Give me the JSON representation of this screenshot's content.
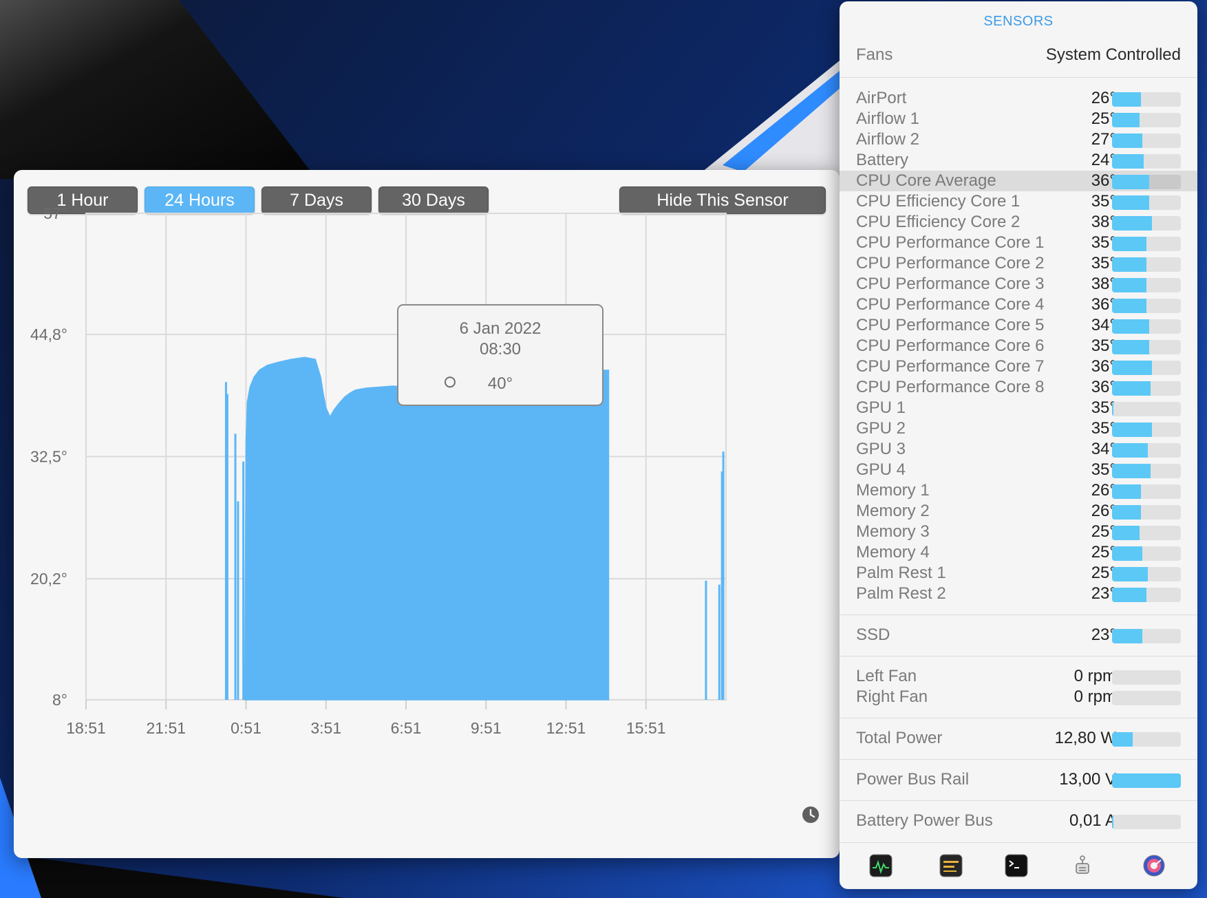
{
  "panel": {
    "title": "SENSORS",
    "fans_label": "Fans",
    "fans_value": "System Controlled",
    "temperature_sensors": [
      {
        "name": "AirPort",
        "value": "26°",
        "level": 0.42
      },
      {
        "name": "Airflow 1",
        "value": "25°",
        "level": 0.4
      },
      {
        "name": "Airflow 2",
        "value": "27°",
        "level": 0.44
      },
      {
        "name": "Battery",
        "value": "24°",
        "level": 0.46
      },
      {
        "name": "CPU Core Average",
        "value": "36°",
        "level": 0.54,
        "highlighted": true
      },
      {
        "name": "CPU Efficiency Core 1",
        "value": "35°",
        "level": 0.54
      },
      {
        "name": "CPU Efficiency Core 2",
        "value": "38°",
        "level": 0.58
      },
      {
        "name": "CPU Performance Core 1",
        "value": "35°",
        "level": 0.5
      },
      {
        "name": "CPU Performance Core 2",
        "value": "35°",
        "level": 0.5
      },
      {
        "name": "CPU Performance Core 3",
        "value": "38°",
        "level": 0.5
      },
      {
        "name": "CPU Performance Core 4",
        "value": "36°",
        "level": 0.5
      },
      {
        "name": "CPU Performance Core 5",
        "value": "34°",
        "level": 0.54
      },
      {
        "name": "CPU Performance Core 6",
        "value": "35°",
        "level": 0.54
      },
      {
        "name": "CPU Performance Core 7",
        "value": "36°",
        "level": 0.58
      },
      {
        "name": "CPU Performance Core 8",
        "value": "36°",
        "level": 0.56
      },
      {
        "name": "GPU 1",
        "value": "35°",
        "level": 0.02
      },
      {
        "name": "GPU 2",
        "value": "35°",
        "level": 0.58
      },
      {
        "name": "GPU 3",
        "value": "34°",
        "level": 0.52
      },
      {
        "name": "GPU 4",
        "value": "35°",
        "level": 0.56
      },
      {
        "name": "Memory 1",
        "value": "26°",
        "level": 0.42
      },
      {
        "name": "Memory 2",
        "value": "26°",
        "level": 0.42
      },
      {
        "name": "Memory 3",
        "value": "25°",
        "level": 0.4
      },
      {
        "name": "Memory 4",
        "value": "25°",
        "level": 0.44
      },
      {
        "name": "Palm Rest 1",
        "value": "25°",
        "level": 0.52
      },
      {
        "name": "Palm Rest 2",
        "value": "23°",
        "level": 0.5
      }
    ],
    "ssd": {
      "name": "SSD",
      "value": "23°",
      "level": 0.44
    },
    "fans": [
      {
        "name": "Left Fan",
        "value": "0 rpm",
        "level": 0
      },
      {
        "name": "Right Fan",
        "value": "0 rpm",
        "level": 0
      }
    ],
    "total_power": {
      "name": "Total Power",
      "value": "12,80 W",
      "level": 0.3
    },
    "power_bus_rail": {
      "name": "Power Bus Rail",
      "value": "13,00 V",
      "level": 1.0
    },
    "battery_power_bus": {
      "name": "Battery Power Bus",
      "value": "0,01 A",
      "level": 0.02
    },
    "dock_icons": [
      "activity-monitor-icon",
      "console-icon",
      "terminal-icon",
      "system-information-icon",
      "disk-utility-icon"
    ]
  },
  "history": {
    "range_buttons": [
      "1 Hour",
      "24 Hours",
      "7 Days",
      "30 Days"
    ],
    "active_range": "24 Hours",
    "hide_button": "Hide This Sensor",
    "tooltip": {
      "date": "6 Jan 2022",
      "time": "08:30",
      "value": "40°"
    },
    "reset_icon": "clock-icon"
  },
  "chart_data": {
    "type": "area",
    "ytick_labels": [
      "57°",
      "44,8°",
      "32,5°",
      "20,2°",
      "8°"
    ],
    "yticks": [
      57,
      44.8,
      32.5,
      20.2,
      8
    ],
    "ylim": [
      8,
      57
    ],
    "xtick_labels": [
      "18:51",
      "21:51",
      "0:51",
      "3:51",
      "6:51",
      "9:51",
      "12:51",
      "15:51"
    ],
    "xlim_hours": [
      0,
      24
    ],
    "grid": true,
    "color": "#5cb6f5",
    "main_series": {
      "x_hours": [
        5.95,
        6.0,
        6.05,
        6.15,
        6.3,
        6.5,
        6.8,
        7.2,
        7.7,
        8.2,
        8.6,
        8.8,
        8.9,
        9.0,
        9.15,
        9.3,
        9.5,
        9.7,
        9.9,
        10.1,
        10.5,
        11.0,
        11.5,
        12.0,
        12.5,
        13.0,
        13.5,
        13.8,
        14.0,
        14.5,
        15.0,
        15.5,
        16.0,
        16.5,
        17.0,
        17.5,
        18.0,
        18.5,
        19.0,
        19.6
      ],
      "y": [
        8,
        34.0,
        38.0,
        39.5,
        40.5,
        41.2,
        41.7,
        42.0,
        42.3,
        42.5,
        42.3,
        40.5,
        38.8,
        37.4,
        36.5,
        37.2,
        37.9,
        38.5,
        38.9,
        39.2,
        39.4,
        39.5,
        39.6,
        39.5,
        39.7,
        39.6,
        39.8,
        40.0,
        40.0,
        40.2,
        40.3,
        40.5,
        40.6,
        40.8,
        40.9,
        41.0,
        41.1,
        41.1,
        41.2,
        41.2
      ]
    },
    "spikes": [
      {
        "x_hours": 5.25,
        "y": 40.0
      },
      {
        "x_hours": 5.3,
        "y": 38.8
      },
      {
        "x_hours": 5.6,
        "y": 34.8
      },
      {
        "x_hours": 5.7,
        "y": 28.0
      },
      {
        "x_hours": 5.9,
        "y": 32.0
      },
      {
        "x_hours": 23.25,
        "y": 20.0
      },
      {
        "x_hours": 23.75,
        "y": 19.6
      },
      {
        "x_hours": 23.85,
        "y": 31.0
      },
      {
        "x_hours": 23.9,
        "y": 33.0
      }
    ],
    "tooltip_point": {
      "x_hours": 13.65,
      "y": 40.0
    }
  }
}
